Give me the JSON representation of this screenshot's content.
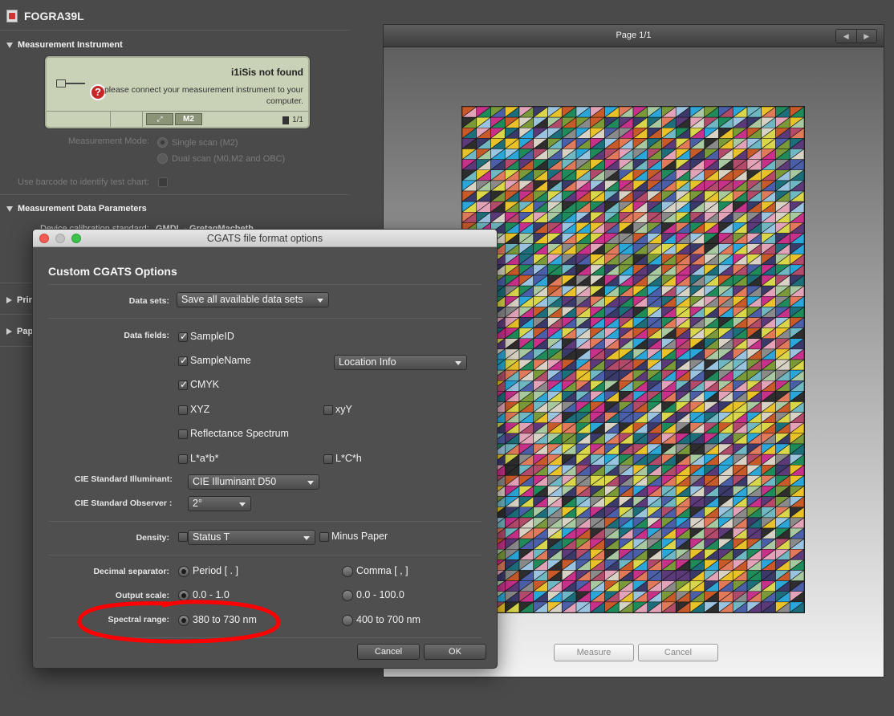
{
  "app": {
    "title": "FOGRA39L"
  },
  "left_panel": {
    "instrument_section": "Measurement Instrument",
    "instrument": {
      "name_status": "i1iSis not found",
      "message": "please connect your measurement instrument to your computer.",
      "mode_badge": "M2",
      "page_count": "1/1"
    },
    "measurement_mode_label": "Measurement Mode:",
    "mode_options": [
      "Single scan (M2)",
      "Dual scan (M0,M2 and OBC)"
    ],
    "barcode_label": "Use barcode to identify test chart:",
    "data_params_section": "Measurement Data Parameters",
    "device_calibration_label": "Device calibration standard:",
    "device_calibration_value": "GMDL - GretagMacbeth",
    "collapsed_sections": [
      "Prin",
      "Pap"
    ]
  },
  "preview": {
    "page_label": "Page 1/1",
    "nav_prev": "◀",
    "nav_next": "▶",
    "measure_button": "Measure",
    "cancel_button": "Cancel",
    "palette": [
      "#d8d2c4",
      "#e9c229",
      "#c7318a",
      "#2aa6d8",
      "#1f8a5a",
      "#3a3a6a",
      "#b24a6a",
      "#6fb7c2",
      "#7a9a3a",
      "#c85a2a",
      "#4b5fa8",
      "#e2a3b8",
      "#2d2d2d",
      "#9ac3e0",
      "#5c3a7a",
      "#d9d64a",
      "#8a8a8a",
      "#1b6e7a",
      "#e07a5a",
      "#a8c8a0"
    ]
  },
  "dialog": {
    "title": "CGATS file format options",
    "heading": "Custom CGATS Options",
    "data_sets_label": "Data sets:",
    "data_sets_value": "Save all available data sets",
    "data_fields_label": "Data fields:",
    "fields": {
      "sample_id": "SampleID",
      "sample_name": "SampleName",
      "location_info": "Location Info",
      "cmyk": "CMYK",
      "xyz": "XYZ",
      "xyy": "xyY",
      "reflectance": "Reflectance Spectrum",
      "lab": "L*a*b*",
      "lch": "L*C*h"
    },
    "illuminant_label": "CIE Standard Illuminant:",
    "illuminant_value": "CIE Illuminant D50",
    "observer_label": "CIE Standard Observer :",
    "observer_value": "2°",
    "density_label": "Density:",
    "density_value": "Status T",
    "minus_paper": "Minus Paper",
    "decimal_label": "Decimal separator:",
    "decimal_options": [
      "Period [ . ]",
      "Comma [ , ]"
    ],
    "output_scale_label": "Output scale:",
    "output_scale_options": [
      "0.0 - 1.0",
      "0.0 - 100.0"
    ],
    "spectral_label": "Spectral range:",
    "spectral_options": [
      "380 to 730 nm",
      "400 to 700 nm"
    ],
    "cancel": "Cancel",
    "ok": "OK"
  },
  "annotation_color": "#ff0000"
}
